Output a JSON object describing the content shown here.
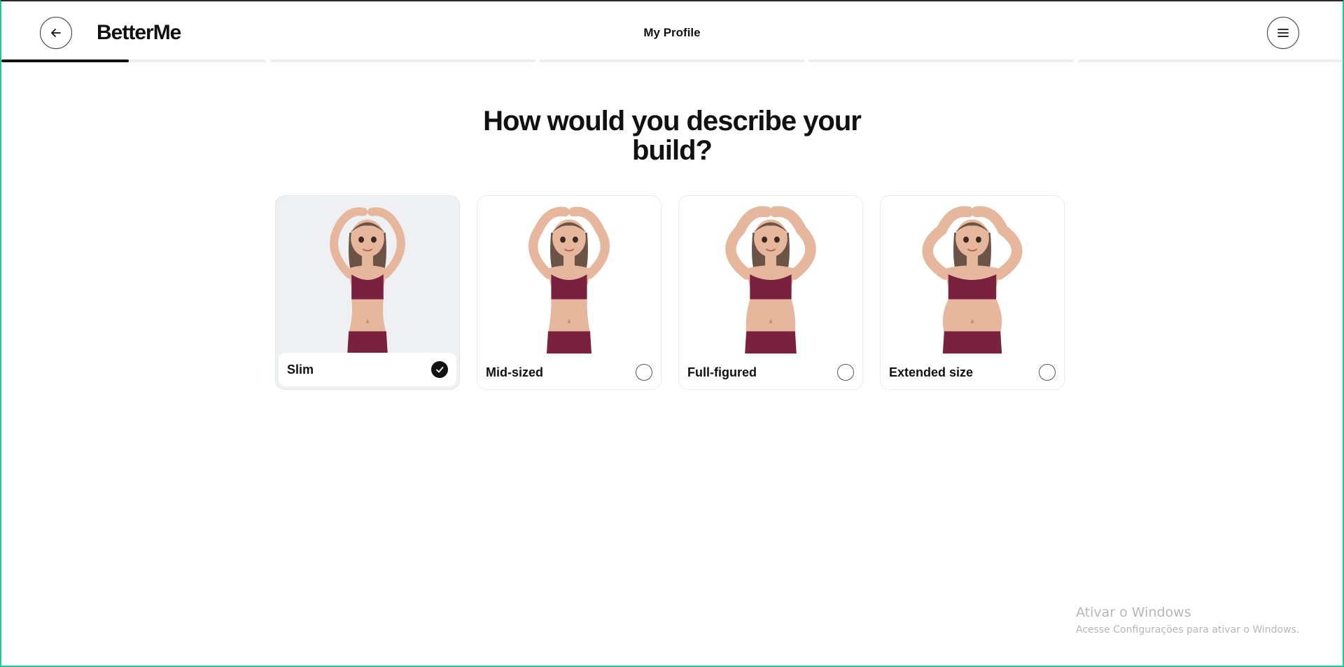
{
  "header": {
    "brand": "BetterMe",
    "title": "My Profile"
  },
  "progress": {
    "segments": 5,
    "current_fill": 0.48
  },
  "question": "How would you describe your build?",
  "options": [
    {
      "label": "Slim",
      "selected": true
    },
    {
      "label": "Mid-sized",
      "selected": false
    },
    {
      "label": "Full-figured",
      "selected": false
    },
    {
      "label": "Extended size",
      "selected": false
    }
  ],
  "watermark": {
    "line1": "Ativar o Windows",
    "line2": "Acesse Configurações para ativar o Windows."
  },
  "colors": {
    "accent": "#111111",
    "selected_card_bg": "#eff0f4",
    "outfit": "#7a2140",
    "skin": "#e6b79d",
    "hair": "#6b5446",
    "window_border": "#1fc99a"
  },
  "icons": {
    "back": "arrow-left-icon",
    "menu": "hamburger-menu-icon",
    "check": "checkmark-icon"
  }
}
